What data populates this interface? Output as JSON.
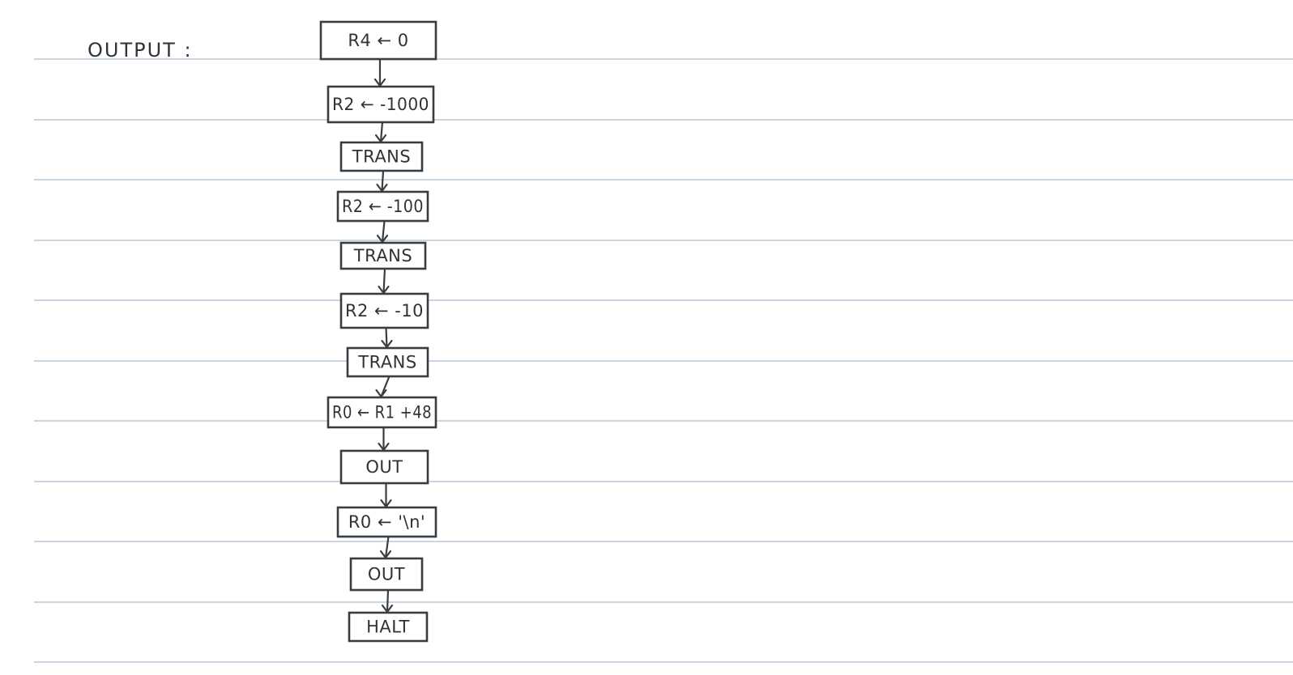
{
  "heading": "OUTPUT :",
  "nodes": [
    {
      "id": "n1",
      "label": "R4 ← 0"
    },
    {
      "id": "n2",
      "label": "R2 ← -1000"
    },
    {
      "id": "n3",
      "label": "TRANS"
    },
    {
      "id": "n4",
      "label": "R2 ← -100"
    },
    {
      "id": "n5",
      "label": "TRANS"
    },
    {
      "id": "n6",
      "label": "R2 ← -10"
    },
    {
      "id": "n7",
      "label": "TRANS"
    },
    {
      "id": "n8",
      "label": "R0 ← R1 +48"
    },
    {
      "id": "n9",
      "label": "OUT"
    },
    {
      "id": "n10",
      "label": "R0 ← '\\n'"
    },
    {
      "id": "n11",
      "label": "OUT"
    },
    {
      "id": "n12",
      "label": "HALT"
    }
  ],
  "edges": [
    {
      "from": "n1",
      "to": "n2"
    },
    {
      "from": "n2",
      "to": "n3"
    },
    {
      "from": "n3",
      "to": "n4"
    },
    {
      "from": "n4",
      "to": "n5"
    },
    {
      "from": "n5",
      "to": "n6"
    },
    {
      "from": "n6",
      "to": "n7"
    },
    {
      "from": "n7",
      "to": "n8"
    },
    {
      "from": "n8",
      "to": "n9"
    },
    {
      "from": "n9",
      "to": "n10"
    },
    {
      "from": "n10",
      "to": "n11"
    },
    {
      "from": "n11",
      "to": "n12"
    }
  ],
  "colors": {
    "ink": "#3a3d40",
    "ruled_line": "#b8cad8",
    "paper": "#ffffff"
  }
}
